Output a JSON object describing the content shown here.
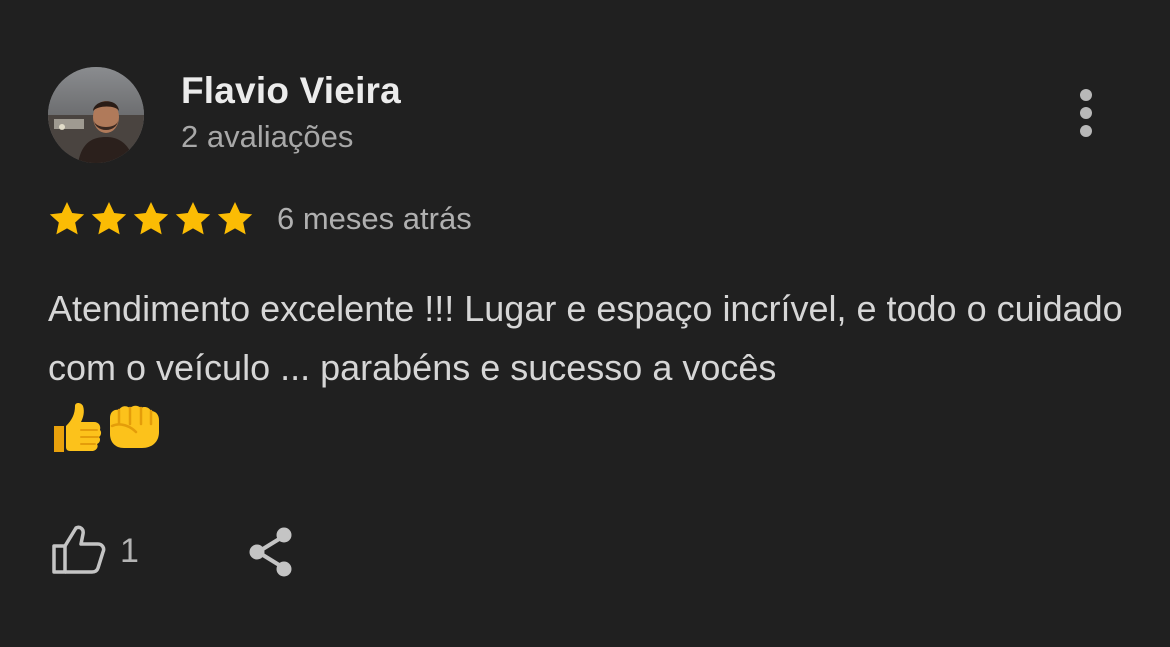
{
  "reviewer": {
    "name": "Flavio Vieira",
    "review_count": "2 avaliações",
    "avatar": "profile-photo"
  },
  "rating": {
    "stars": 5,
    "max_stars": 5,
    "star_color": "#FBBC04"
  },
  "review": {
    "time_ago": "6 meses atrás",
    "text": "Atendimento excelente !!! Lugar e espaço incrível, e todo o cuidado com o veículo ... parabéns e sucesso a vocês",
    "emojis": [
      "thumbs-up-emoji",
      "oncoming-fist-emoji"
    ]
  },
  "actions": {
    "like_icon": "thumbs-up-icon",
    "like_count": "1",
    "share_icon": "share-icon",
    "more_icon": "more-vertical-icon"
  },
  "colors": {
    "background": "#202020",
    "name": "#ececec",
    "secondary_text": "#a8a8a8",
    "body_text": "#d6d6d6"
  }
}
